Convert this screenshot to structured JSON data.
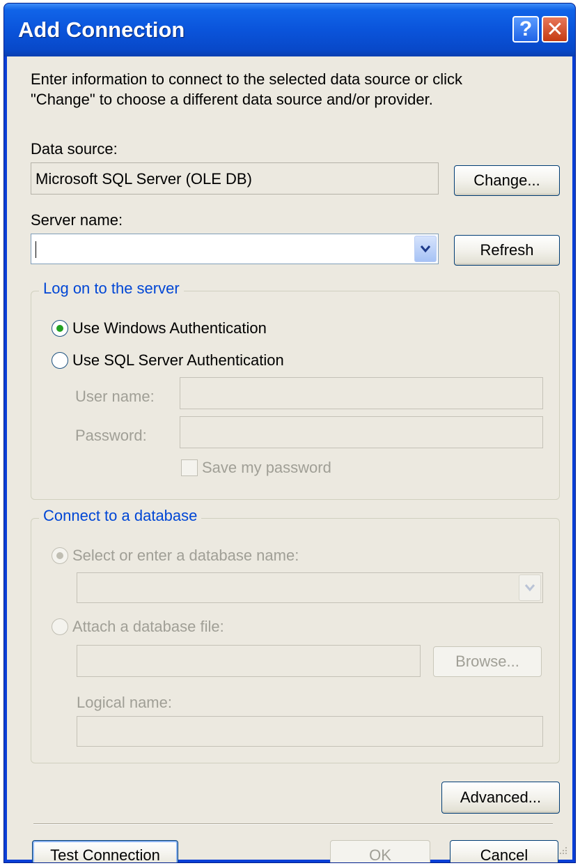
{
  "window": {
    "title": "Add Connection",
    "help_icon": "?",
    "close_icon": "✕"
  },
  "intro": {
    "line1": "Enter information to connect to the selected data source or click",
    "line2": "\"Change\" to choose a different data source and/or provider."
  },
  "data_source": {
    "label": "Data source:",
    "value": "Microsoft SQL Server (OLE DB)",
    "change_button": "Change..."
  },
  "server": {
    "label": "Server name:",
    "value": "",
    "refresh_button": "Refresh"
  },
  "logon": {
    "legend": "Log on to the server",
    "windows_auth": "Use Windows Authentication",
    "sql_auth": "Use SQL Server Authentication",
    "selected": "windows",
    "username_label": "User name:",
    "password_label": "Password:",
    "save_password": "Save my password"
  },
  "database": {
    "legend": "Connect to a database",
    "select_option": "Select or enter a database name:",
    "attach_option": "Attach a database file:",
    "browse_button": "Browse...",
    "logical_name_label": "Logical name:"
  },
  "buttons": {
    "advanced": "Advanced...",
    "test_connection": "Test Connection",
    "ok": "OK",
    "cancel": "Cancel"
  },
  "colors": {
    "titlebar": "#0a54db",
    "dialog_bg": "#ece9e0",
    "group_legend": "#0046d5",
    "radio_dot": "#21a121"
  }
}
